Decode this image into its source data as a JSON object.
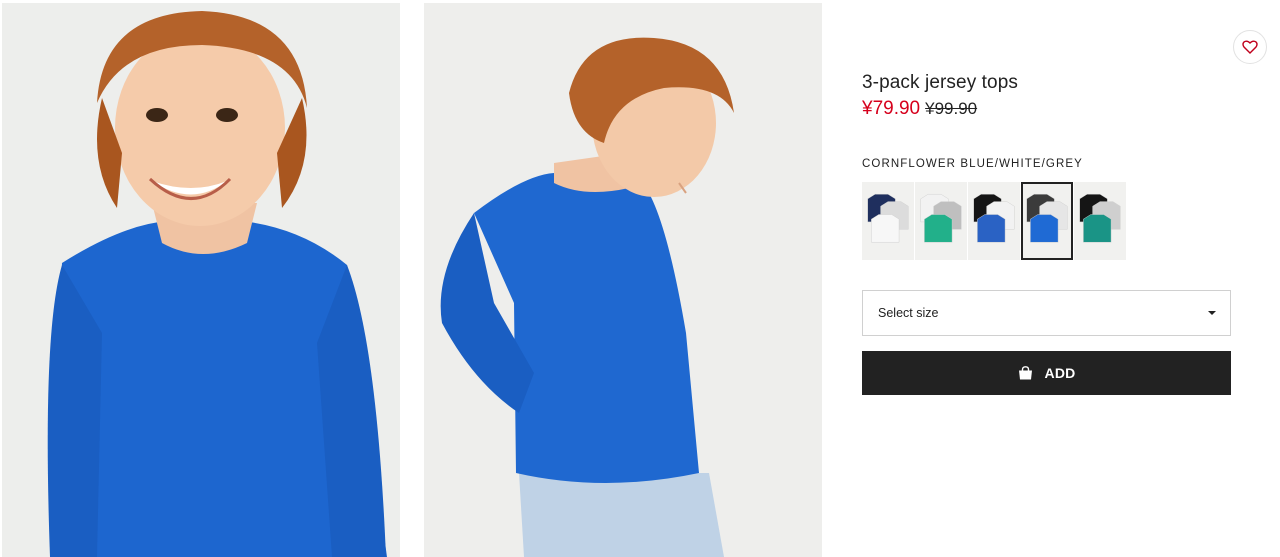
{
  "product": {
    "title": "3-pack jersey tops",
    "price_now": "¥79.90",
    "price_was": "¥99.90"
  },
  "colors": {
    "selected_name": "CORNFLOWER BLUE/WHITE/GREY",
    "options": [
      {
        "name": "dark blue/white/grey",
        "shirts": [
          "#1f2f5e",
          "#dcdcdc",
          "#f7f7f7"
        ]
      },
      {
        "name": "white/grey/green",
        "shirts": [
          "#f2f2f2",
          "#bfbfbf",
          "#22b08a"
        ]
      },
      {
        "name": "black/white/blue",
        "shirts": [
          "#151515",
          "#f2f2f2",
          "#2a62c4"
        ]
      },
      {
        "name": "cornflower blue/white/grey",
        "shirts": [
          "#3b3b3b",
          "#e6e6e6",
          "#1f6ad4"
        ],
        "selected": true
      },
      {
        "name": "black/grey/turquoise",
        "shirts": [
          "#151515",
          "#cfcfcf",
          "#1a9486"
        ]
      }
    ]
  },
  "size_select": {
    "label": "Select size"
  },
  "actions": {
    "add_label": "ADD"
  },
  "colors_theme": {
    "sale_red": "#d6001c",
    "button_dark": "#222222",
    "shirt_blue": "#1f6ad4"
  }
}
